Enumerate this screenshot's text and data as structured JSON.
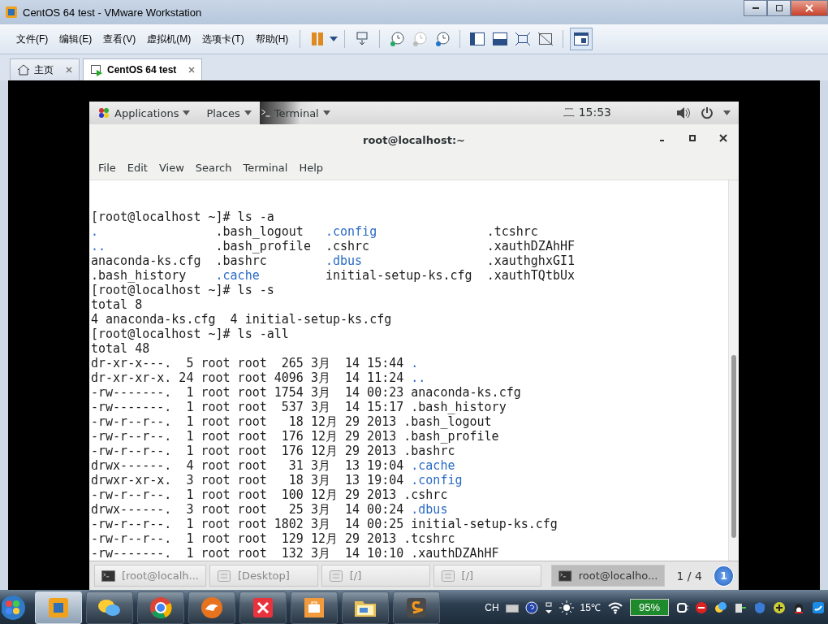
{
  "window": {
    "title": "CentOS 64 test - VMware Workstation"
  },
  "menu": [
    "文件(F)",
    "编辑(E)",
    "查看(V)",
    "虚拟机(M)",
    "选项卡(T)",
    "帮助(H)"
  ],
  "tabs": [
    {
      "label": "主页",
      "selected": false
    },
    {
      "label": "CentOS 64 test",
      "selected": true
    }
  ],
  "guest": {
    "top_bar": {
      "menus": [
        "Applications",
        "Places",
        "Terminal"
      ],
      "clock": "二 15:53"
    },
    "terminal": {
      "title": "root@localhost:~",
      "menu": [
        "File",
        "Edit",
        "View",
        "Search",
        "Terminal",
        "Help"
      ],
      "lines": [
        {
          "kind": "text",
          "text": "[root@localhost ~]# ls -a"
        },
        {
          "kind": "columns",
          "cells": [
            {
              "text": ".",
              "dir": true
            },
            {
              "text": ".bash_logout",
              "dir": false
            },
            {
              "text": ".config",
              "dir": true
            },
            {
              "text": ".tcshrc",
              "dir": false
            }
          ]
        },
        {
          "kind": "columns",
          "cells": [
            {
              "text": "..",
              "dir": true
            },
            {
              "text": ".bash_profile",
              "dir": false
            },
            {
              "text": ".cshrc",
              "dir": false
            },
            {
              "text": ".xauthDZAhHF",
              "dir": false
            }
          ]
        },
        {
          "kind": "columns",
          "cells": [
            {
              "text": "anaconda-ks.cfg",
              "dir": false
            },
            {
              "text": ".bashrc",
              "dir": false
            },
            {
              "text": ".dbus",
              "dir": true
            },
            {
              "text": ".xauthghxGI1",
              "dir": false
            }
          ]
        },
        {
          "kind": "columns",
          "cells": [
            {
              "text": ".bash_history",
              "dir": false
            },
            {
              "text": ".cache",
              "dir": true
            },
            {
              "text": "initial-setup-ks.cfg",
              "dir": false
            },
            {
              "text": ".xauthTQtbUx",
              "dir": false
            }
          ]
        },
        {
          "kind": "text",
          "text": "[root@localhost ~]# ls -s"
        },
        {
          "kind": "text",
          "text": "total 8"
        },
        {
          "kind": "text",
          "text": "4 anaconda-ks.cfg  4 initial-setup-ks.cfg"
        },
        {
          "kind": "text",
          "text": "[root@localhost ~]# ls -all"
        },
        {
          "kind": "text",
          "text": "total 48"
        },
        {
          "kind": "entry",
          "info": "dr-xr-x---.  5 root root  265 3月  14 15:44",
          "name": ".",
          "dir": true
        },
        {
          "kind": "entry",
          "info": "dr-xr-xr-x. 24 root root 4096 3月  14 11:24",
          "name": "..",
          "dir": true
        },
        {
          "kind": "entry",
          "info": "-rw-------.  1 root root 1754 3月  14 00:23",
          "name": "anaconda-ks.cfg",
          "dir": false
        },
        {
          "kind": "entry",
          "info": "-rw-------.  1 root root  537 3月  14 15:17",
          "name": ".bash_history",
          "dir": false
        },
        {
          "kind": "entry",
          "info": "-rw-r--r--.  1 root root   18 12月 29 2013",
          "name": ".bash_logout",
          "dir": false
        },
        {
          "kind": "entry",
          "info": "-rw-r--r--.  1 root root  176 12月 29 2013",
          "name": ".bash_profile",
          "dir": false
        },
        {
          "kind": "entry",
          "info": "-rw-r--r--.  1 root root  176 12月 29 2013",
          "name": ".bashrc",
          "dir": false
        },
        {
          "kind": "entry",
          "info": "drwx------.  4 root root   31 3月  13 19:04",
          "name": ".cache",
          "dir": true
        },
        {
          "kind": "entry",
          "info": "drwxr-xr-x.  3 root root   18 3月  13 19:04",
          "name": ".config",
          "dir": true
        },
        {
          "kind": "entry",
          "info": "-rw-r--r--.  1 root root  100 12月 29 2013",
          "name": ".cshrc",
          "dir": false
        },
        {
          "kind": "entry",
          "info": "drwx------.  3 root root   25 3月  14 00:24",
          "name": ".dbus",
          "dir": true
        },
        {
          "kind": "entry",
          "info": "-rw-r--r--.  1 root root 1802 3月  14 00:25",
          "name": "initial-setup-ks.cfg",
          "dir": false
        },
        {
          "kind": "entry",
          "info": "-rw-r--r--.  1 root root  129 12月 29 2013",
          "name": ".tcshrc",
          "dir": false
        },
        {
          "kind": "entry",
          "info": "-rw-------.  1 root root  132 3月  14 10:10",
          "name": ".xauthDZAhHF",
          "dir": false
        }
      ]
    },
    "window_list": {
      "items": [
        {
          "label": "[root@localh...",
          "kind": "terminal",
          "selected": false
        },
        {
          "label": "[Desktop]",
          "kind": "folder",
          "selected": false
        },
        {
          "label": "[/]",
          "kind": "folder",
          "selected": false
        },
        {
          "label": "[/]",
          "kind": "folder",
          "selected": false
        },
        {
          "label": "root@localho...",
          "kind": "terminal",
          "selected": true
        }
      ],
      "workspace": "1 / 4",
      "badge": "1"
    }
  },
  "taskbar": {
    "apps": [
      {
        "kind": "vmware",
        "selected": true
      },
      {
        "kind": "chat",
        "selected": false
      },
      {
        "kind": "browser",
        "selected": false
      },
      {
        "kind": "fox",
        "selected": false
      },
      {
        "kind": "xmind",
        "selected": false
      },
      {
        "kind": "briefcase",
        "selected": false
      },
      {
        "kind": "folder",
        "selected": false
      },
      {
        "kind": "editor",
        "selected": false
      }
    ],
    "language": "CH",
    "temperature": "15℃",
    "battery": "95%"
  }
}
